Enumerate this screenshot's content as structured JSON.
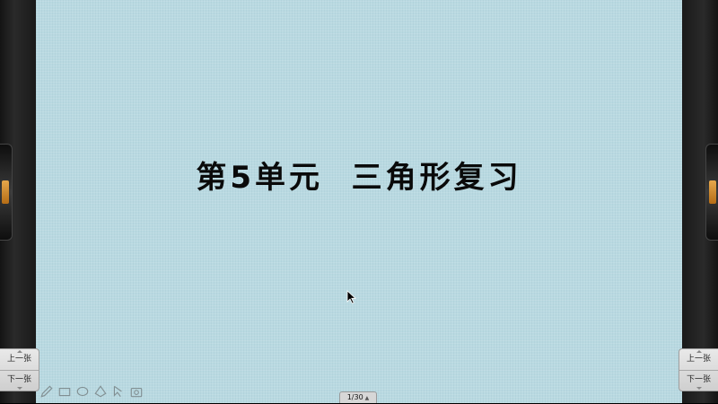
{
  "slide": {
    "title": "第5单元  三角形复习"
  },
  "nav": {
    "prev_label": "上一张",
    "next_label": "下一张"
  },
  "footer": {
    "page_indicator": "1/30"
  },
  "tools": [
    "pen-icon",
    "eraser-icon",
    "highlighter-icon",
    "shape-icon",
    "pointer-icon",
    "camera-icon"
  ],
  "colors": {
    "slide_background": "#b9d9e1",
    "title_text": "#0a0a0a",
    "side_bar": "#1f1f1f",
    "handle_accent": "#d58b2a"
  }
}
